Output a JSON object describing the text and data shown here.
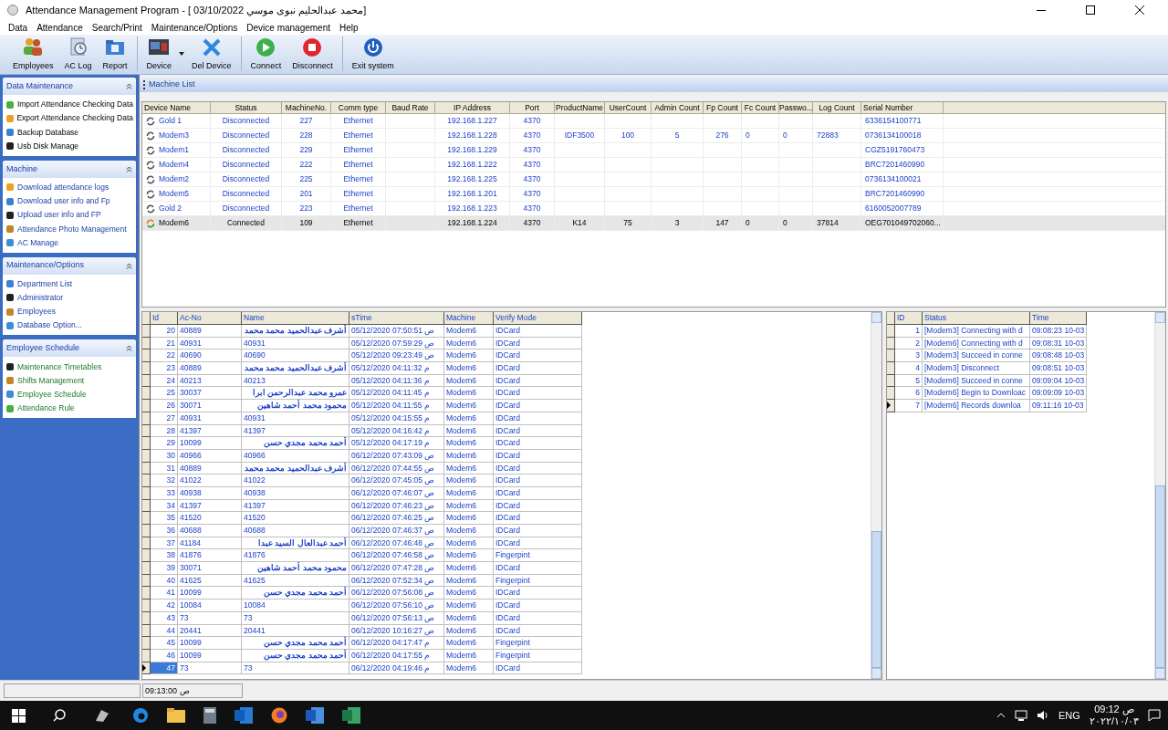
{
  "window": {
    "title": "Attendance Management Program - [ 03/10/2022 محمد عبدالحليم نبوى موسي]"
  },
  "menu": [
    "Data",
    "Attendance",
    "Search/Print",
    "Maintenance/Options",
    "Device management",
    "Help"
  ],
  "toolbar": [
    [
      {
        "label": "Employees",
        "dropdown": false
      },
      {
        "label": "AC Log",
        "dropdown": false
      },
      {
        "label": "Report",
        "dropdown": false
      }
    ],
    [
      {
        "label": "Device",
        "dropdown": true
      },
      {
        "label": "Del Device",
        "dropdown": false
      }
    ],
    [
      {
        "label": "Connect",
        "dropdown": false
      },
      {
        "label": "Disconnect",
        "dropdown": false
      }
    ],
    [
      {
        "label": "Exit system",
        "dropdown": false
      }
    ]
  ],
  "sidebar": [
    {
      "title": "Data Maintenance",
      "expanded": true,
      "items": [
        "Import Attendance Checking Data",
        "Export Attendance Checking Data",
        "Backup Database",
        "Usb Disk Manage"
      ]
    },
    {
      "title": "Machine",
      "expanded": true,
      "items": [
        "Download attendance logs",
        "Download user info and Fp",
        "Upload user info and FP",
        "Attendance Photo Management",
        "AC Manage"
      ]
    },
    {
      "title": "Maintenance/Options",
      "expanded": true,
      "items": [
        "Department List",
        "Administrator",
        "Employees",
        "Database Option..."
      ]
    },
    {
      "title": "Employee Schedule",
      "expanded": true,
      "items": [
        "Maintenance Timetables",
        "Shifts Management",
        "Employee Schedule",
        "Attendance Rule"
      ]
    }
  ],
  "machine_list": {
    "title": "Machine List",
    "columns": [
      "Device Name",
      "Status",
      "MachineNo.",
      "Comm type",
      "Baud Rate",
      "IP Address",
      "Port",
      "ProductName",
      "UserCount",
      "Admin Count",
      "Fp Count",
      "Fc Count",
      "Passwo...",
      "Log Count",
      "Serial Number"
    ],
    "rows": [
      {
        "connected": false,
        "selected": false,
        "cells": [
          "Gold 1",
          "Disconnected",
          "227",
          "Ethernet",
          "",
          "192.168.1.227",
          "4370",
          "",
          "",
          "",
          "",
          "",
          "",
          "",
          "6336154100771"
        ]
      },
      {
        "connected": false,
        "selected": false,
        "cells": [
          "Modem3",
          "Disconnected",
          "228",
          "Ethernet",
          "",
          "192.168.1.228",
          "4370",
          "IDF3500",
          "100",
          "5",
          "276",
          "0",
          "0",
          "72883",
          "0736134100018"
        ]
      },
      {
        "connected": false,
        "selected": false,
        "cells": [
          "Modem1",
          "Disconnected",
          "229",
          "Ethernet",
          "",
          "192.168.1.229",
          "4370",
          "",
          "",
          "",
          "",
          "",
          "",
          "",
          "CGZ5191760473"
        ]
      },
      {
        "connected": false,
        "selected": false,
        "cells": [
          "Modem4",
          "Disconnected",
          "222",
          "Ethernet",
          "",
          "192.168.1.222",
          "4370",
          "",
          "",
          "",
          "",
          "",
          "",
          "",
          "BRC7201460990"
        ]
      },
      {
        "connected": false,
        "selected": false,
        "cells": [
          "Modem2",
          "Disconnected",
          "225",
          "Ethernet",
          "",
          "192.168.1.225",
          "4370",
          "",
          "",
          "",
          "",
          "",
          "",
          "",
          "0736134100021"
        ]
      },
      {
        "connected": false,
        "selected": false,
        "cells": [
          "Modem5",
          "Disconnected",
          "201",
          "Ethernet",
          "",
          "192.168.1.201",
          "4370",
          "",
          "",
          "",
          "",
          "",
          "",
          "",
          "BRC7201460990"
        ]
      },
      {
        "connected": false,
        "selected": false,
        "cells": [
          "Gold 2",
          "Disconnected",
          "223",
          "Ethernet",
          "",
          "192.168.1.223",
          "4370",
          "",
          "",
          "",
          "",
          "",
          "",
          "",
          "6160052007789"
        ]
      },
      {
        "connected": true,
        "selected": true,
        "cells": [
          "Modem6",
          "Connected",
          "109",
          "Ethernet",
          "",
          "192.168.1.224",
          "4370",
          "K14",
          "75",
          "3",
          "147",
          "0",
          "0",
          "37814",
          "OEG701049702060..."
        ]
      }
    ]
  },
  "log": {
    "columns": [
      "Id",
      "Ac-No",
      "Name",
      "sTime",
      "Machine",
      "Verify Mode"
    ],
    "rows": [
      {
        "selected": false,
        "cells": [
          "20",
          "40889",
          "أشرف عبدالحميد محمد محمد",
          "05/12/2020 07:50:51 ص",
          "Modem6",
          "IDCard"
        ]
      },
      {
        "selected": false,
        "cells": [
          "21",
          "40931",
          "40931",
          "05/12/2020 07:59:29 ص",
          "Modem6",
          "IDCard"
        ]
      },
      {
        "selected": false,
        "cells": [
          "22",
          "40690",
          "40690",
          "05/12/2020 09:23:49 ص",
          "Modem6",
          "IDCard"
        ]
      },
      {
        "selected": false,
        "cells": [
          "23",
          "40889",
          "أشرف عبدالحميد محمد محمد",
          "05/12/2020 04:11:32 م",
          "Modem6",
          "IDCard"
        ]
      },
      {
        "selected": false,
        "cells": [
          "24",
          "40213",
          "40213",
          "05/12/2020 04:11:36 م",
          "Modem6",
          "IDCard"
        ]
      },
      {
        "selected": false,
        "cells": [
          "25",
          "30037",
          "عمرو محمد عبدالرحمن ابرا",
          "05/12/2020 04:11:45 م",
          "Modem6",
          "IDCard"
        ]
      },
      {
        "selected": false,
        "cells": [
          "26",
          "30071",
          "محمود محمد أحمد شاهين",
          "05/12/2020 04:11:55 م",
          "Modem6",
          "IDCard"
        ]
      },
      {
        "selected": false,
        "cells": [
          "27",
          "40931",
          "40931",
          "05/12/2020 04:15:55 م",
          "Modem6",
          "IDCard"
        ]
      },
      {
        "selected": false,
        "cells": [
          "28",
          "41397",
          "41397",
          "05/12/2020 04:16:42 م",
          "Modem6",
          "IDCard"
        ]
      },
      {
        "selected": false,
        "cells": [
          "29",
          "10099",
          "أحمد محمد مجدي حسن",
          "05/12/2020 04:17:19 م",
          "Modem6",
          "IDCard"
        ]
      },
      {
        "selected": false,
        "cells": [
          "30",
          "40966",
          "40966",
          "06/12/2020 07:43:09 ص",
          "Modem6",
          "IDCard"
        ]
      },
      {
        "selected": false,
        "cells": [
          "31",
          "40889",
          "أشرف عبدالحميد محمد محمد",
          "06/12/2020 07:44:55 ص",
          "Modem6",
          "IDCard"
        ]
      },
      {
        "selected": false,
        "cells": [
          "32",
          "41022",
          "41022",
          "06/12/2020 07:45:05 ص",
          "Modem6",
          "IDCard"
        ]
      },
      {
        "selected": false,
        "cells": [
          "33",
          "40938",
          "40938",
          "06/12/2020 07:46:07 ص",
          "Modem6",
          "IDCard"
        ]
      },
      {
        "selected": false,
        "cells": [
          "34",
          "41397",
          "41397",
          "06/12/2020 07:46:23 ص",
          "Modem6",
          "IDCard"
        ]
      },
      {
        "selected": false,
        "cells": [
          "35",
          "41520",
          "41520",
          "06/12/2020 07:46:25 ص",
          "Modem6",
          "IDCard"
        ]
      },
      {
        "selected": false,
        "cells": [
          "36",
          "40688",
          "40688",
          "06/12/2020 07:46:37 ص",
          "Modem6",
          "IDCard"
        ]
      },
      {
        "selected": false,
        "cells": [
          "37",
          "41184",
          "أحمد عبدالعال السيد عبدا",
          "06/12/2020 07:46:48 ص",
          "Modem6",
          "IDCard"
        ]
      },
      {
        "selected": false,
        "cells": [
          "38",
          "41876",
          "41876",
          "06/12/2020 07:46:58 ص",
          "Modem6",
          "Fingerpint"
        ]
      },
      {
        "selected": false,
        "cells": [
          "39",
          "30071",
          "محمود محمد أحمد شاهين",
          "06/12/2020 07:47:28 ص",
          "Modem6",
          "IDCard"
        ]
      },
      {
        "selected": false,
        "cells": [
          "40",
          "41625",
          "41625",
          "06/12/2020 07:52:34 ص",
          "Modem6",
          "Fingerpint"
        ]
      },
      {
        "selected": false,
        "cells": [
          "41",
          "10099",
          "أحمد محمد مجدي حسن",
          "06/12/2020 07:56:08 ص",
          "Modem6",
          "IDCard"
        ]
      },
      {
        "selected": false,
        "cells": [
          "42",
          "10084",
          "10084",
          "06/12/2020 07:56:10 ص",
          "Modem6",
          "IDCard"
        ]
      },
      {
        "selected": false,
        "cells": [
          "43",
          "73",
          "73",
          "06/12/2020 07:56:13 ص",
          "Modem6",
          "IDCard"
        ]
      },
      {
        "selected": false,
        "cells": [
          "44",
          "20441",
          "20441",
          "06/12/2020 10:16:27 ص",
          "Modem6",
          "IDCard"
        ]
      },
      {
        "selected": false,
        "cells": [
          "45",
          "10099",
          "أحمد محمد مجدي حسن",
          "06/12/2020 04:17:47 م",
          "Modem6",
          "Fingerpint"
        ]
      },
      {
        "selected": false,
        "cells": [
          "46",
          "10099",
          "أحمد محمد مجدي حسن",
          "06/12/2020 04:17:55 م",
          "Modem6",
          "Fingerpint"
        ]
      },
      {
        "selected": true,
        "cells": [
          "47",
          "73",
          "73",
          "06/12/2020 04:19:46 م",
          "Modem6",
          "IDCard"
        ]
      }
    ]
  },
  "events": {
    "columns": [
      "ID",
      "Status",
      "Time"
    ],
    "rows": [
      {
        "selected": false,
        "cells": [
          "1",
          "[Modem3] Connecting with d",
          "09:08:23 10-03"
        ]
      },
      {
        "selected": false,
        "cells": [
          "2",
          "[Modem6] Connecting with d",
          "09:08:31 10-03"
        ]
      },
      {
        "selected": false,
        "cells": [
          "3",
          "[Modem3] Succeed in conne",
          "09:08:48 10-03"
        ]
      },
      {
        "selected": false,
        "cells": [
          "4",
          "[Modem3] Disconnect",
          "09:08:51 10-03"
        ]
      },
      {
        "selected": false,
        "cells": [
          "5",
          "[Modem6] Succeed in conne",
          "09:09:04 10-03"
        ]
      },
      {
        "selected": false,
        "cells": [
          "6",
          "[Modem6] Begin to Downloac",
          "09:09:09 10-03"
        ]
      },
      {
        "selected": true,
        "cells": [
          "7",
          "[Modem6]  Records downloa",
          "09:11:16 10-03"
        ]
      }
    ]
  },
  "status_bar": [
    "09:13:00 ص"
  ],
  "taskbar": {
    "language": "ENG",
    "time": "ص 09:12",
    "date": "٢٠٢٢/١٠/٠٣"
  }
}
